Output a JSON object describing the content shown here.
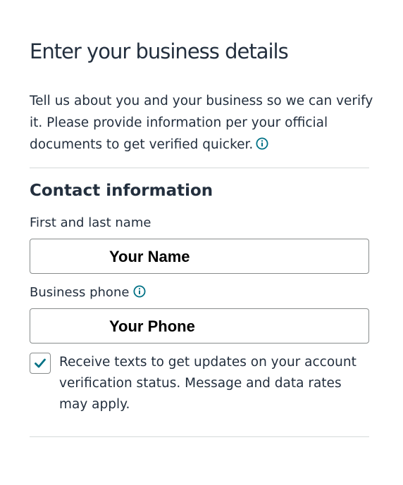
{
  "header": {
    "title": "Enter your business details",
    "intro": "Tell us about you and your business so we can verify it. Please provide information per your official documents to get verified quicker."
  },
  "contact": {
    "section_title": "Contact information",
    "name_label": "First and last name",
    "name_value": "Your Name",
    "phone_label": "Business phone",
    "phone_value": "Your Phone",
    "sms_optin_checked": true,
    "sms_optin_label": "Receive texts to get updates on your account verification status. Message and data rates may apply."
  },
  "icons": {
    "info": "info-icon",
    "check": "checkmark-icon"
  },
  "colors": {
    "text": "#232f3e",
    "accent": "#007185",
    "border": "#888c8c",
    "divider": "#d5d9d9"
  }
}
